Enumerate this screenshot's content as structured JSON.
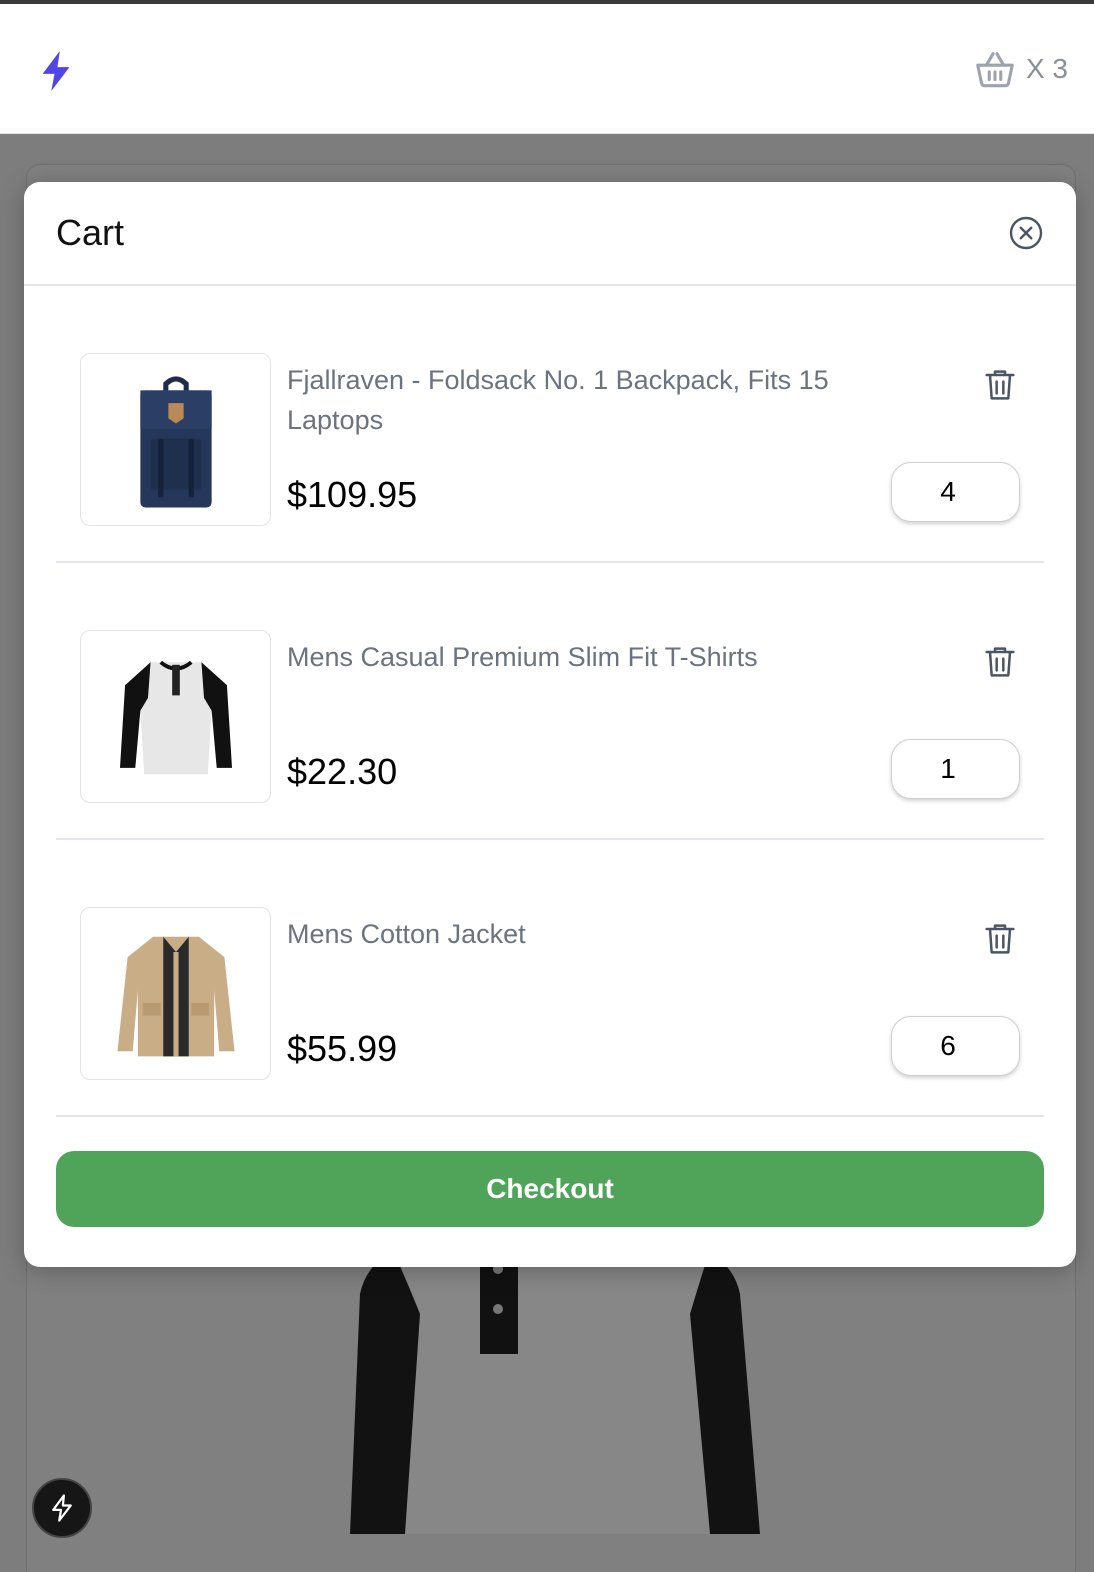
{
  "navbar": {
    "logo_icon": "lightning-bolt-icon",
    "cart_icon": "basket-icon",
    "cart_count_label": "X 3",
    "brand_color": "#4f46e5"
  },
  "modal": {
    "title": "Cart",
    "close_icon": "close-circle-icon",
    "items": [
      {
        "title": "Fjallraven - Foldsack No. 1 Backpack, Fits 15 Laptops",
        "price": "$109.95",
        "quantity": "4",
        "image": "backpack"
      },
      {
        "title": "Mens Casual Premium Slim Fit T-Shirts",
        "price": "$22.30",
        "quantity": "1",
        "image": "raglan-t-shirt"
      },
      {
        "title": "Mens Cotton Jacket",
        "price": "$55.99",
        "quantity": "6",
        "image": "cotton-jacket"
      }
    ],
    "checkout_label": "Checkout",
    "checkout_color": "#50a459"
  },
  "floating": {
    "icon": "lightning-bolt-icon"
  }
}
